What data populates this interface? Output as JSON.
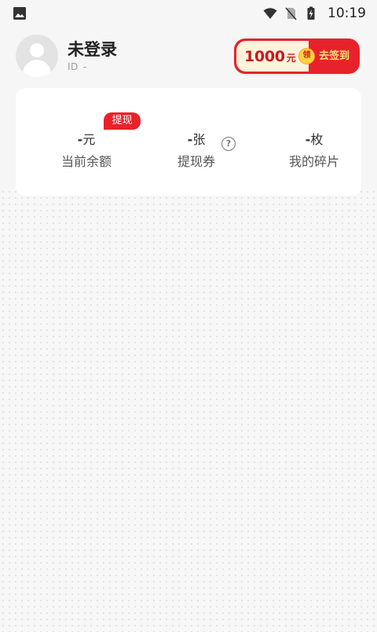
{
  "status_bar": {
    "time": "10:19",
    "icons": [
      "image-icon",
      "wifi-icon",
      "no-sim-icon",
      "battery-charging-icon"
    ]
  },
  "profile": {
    "username": "未登录",
    "id_label": "ID",
    "id_value": "-"
  },
  "signin_banner": {
    "amount": "1000",
    "unit": "元",
    "coin_text": "领",
    "action": "去签到",
    "colors": {
      "background": "#e8222b",
      "amount": "#c81920",
      "action": "#ffe37a"
    }
  },
  "wallet": {
    "balance": {
      "value": "-",
      "unit": "元",
      "label": "当前余额",
      "tag": "提现"
    },
    "coupon": {
      "value": "-",
      "unit": "张",
      "label": "提现券",
      "help": "?"
    },
    "pieces": {
      "value": "-",
      "unit": "枚",
      "label": "我的碎片"
    }
  },
  "colors": {
    "accent": "#e8222b",
    "background": "#f7f7f7",
    "card": "#ffffff"
  }
}
